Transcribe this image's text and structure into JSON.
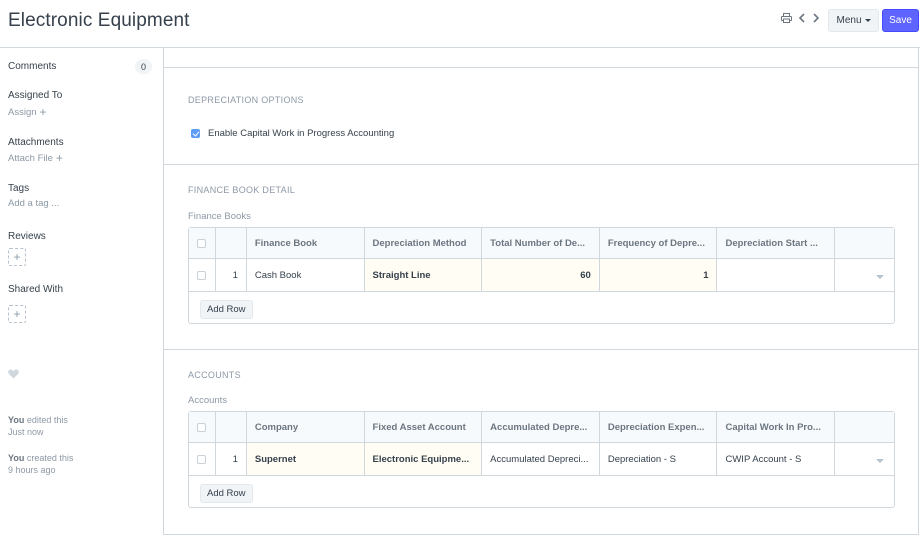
{
  "header": {
    "title": "Electronic Equipment",
    "menu_label": "Menu",
    "save_label": "Save"
  },
  "sidebar": {
    "comments_label": "Comments",
    "comments_count": "0",
    "assigned_to_label": "Assigned To",
    "assign_link": "Assign",
    "attachments_label": "Attachments",
    "attach_file_link": "Attach File",
    "tags_label": "Tags",
    "add_tag_link": "Add a tag ...",
    "reviews_label": "Reviews",
    "shared_with_label": "Shared With",
    "activity": [
      {
        "actor": "You",
        "action": " edited this",
        "when": "Just now"
      },
      {
        "actor": "You",
        "action": " created this",
        "when": "9 hours ago"
      }
    ]
  },
  "depreciation": {
    "heading": "DEPRECIATION OPTIONS",
    "cwip_label": "Enable Capital Work in Progress Accounting",
    "cwip_checked": true
  },
  "finance_book": {
    "heading": "FINANCE BOOK DETAIL",
    "table_label": "Finance Books",
    "columns": [
      "Finance Book",
      "Depreciation Method",
      "Total Number of De...",
      "Frequency of Depre...",
      "Depreciation Start ..."
    ],
    "rows": [
      {
        "idx": "1",
        "cells": [
          "Cash Book",
          "Straight Line",
          "60",
          "1",
          ""
        ]
      }
    ],
    "add_row_label": "Add Row"
  },
  "accounts": {
    "heading": "ACCOUNTS",
    "table_label": "Accounts",
    "columns": [
      "Company",
      "Fixed Asset Account",
      "Accumulated Depre...",
      "Depreciation Expen...",
      "Capital Work In Pro..."
    ],
    "rows": [
      {
        "idx": "1",
        "cells": [
          "Supernet",
          "Electronic Equipme...",
          "Accumulated Depreci...",
          "Depreciation - S",
          "CWIP Account - S"
        ]
      }
    ],
    "add_row_label": "Add Row"
  }
}
